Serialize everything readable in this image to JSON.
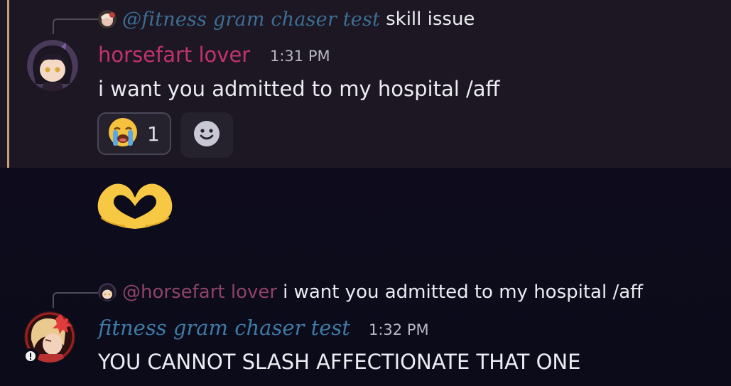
{
  "messages": [
    {
      "reply": {
        "mention": "@fitness gram chaser test",
        "text": "skill issue"
      },
      "author": "horsefart lover",
      "time": "1:31 PM",
      "content": "i want you admitted to my hospital /aff",
      "reactions": [
        {
          "emoji": "loudly-crying-face",
          "count": "1"
        }
      ],
      "highlighted": true
    },
    {
      "author": "horsefart lover",
      "content_emoji": "heart-hands-emoji"
    },
    {
      "reply": {
        "mention": "@horsefart lover",
        "text": "i want you admitted to my hospital /aff"
      },
      "author": "fitness gram chaser test",
      "time": "1:32 PM",
      "content": "YOU CANNOT SLASH AFFECTIONATE THAT ONE"
    }
  ],
  "colors": {
    "background": "#0d0c1c",
    "highlight_bg": "#1c1722",
    "highlight_bar": "#c9a07a",
    "author1": "#c2336e",
    "author2": "#3d7aa6"
  },
  "icons": [
    "add-reaction-icon",
    "loudly-crying-face-emoji",
    "heart-hands-emoji",
    "status-icon"
  ]
}
